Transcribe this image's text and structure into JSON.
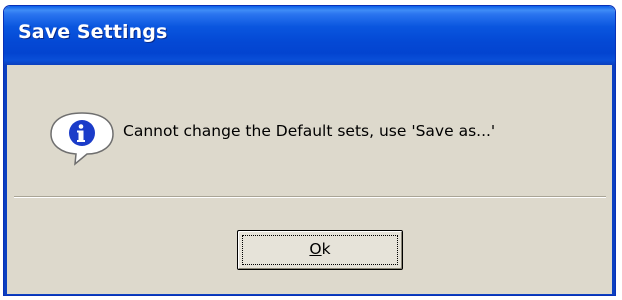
{
  "window": {
    "title": "Save Settings"
  },
  "dialog": {
    "icon": "info-bubble-icon",
    "message": "Cannot change the Default sets, use 'Save as...'"
  },
  "buttons": {
    "ok": {
      "mnemonic": "O",
      "rest": "k"
    }
  },
  "colors": {
    "titlebar": "#0449d5",
    "frame": "#0b3fc0",
    "client_background": "#ddd9cc",
    "icon_accent": "#1b3cc9"
  }
}
